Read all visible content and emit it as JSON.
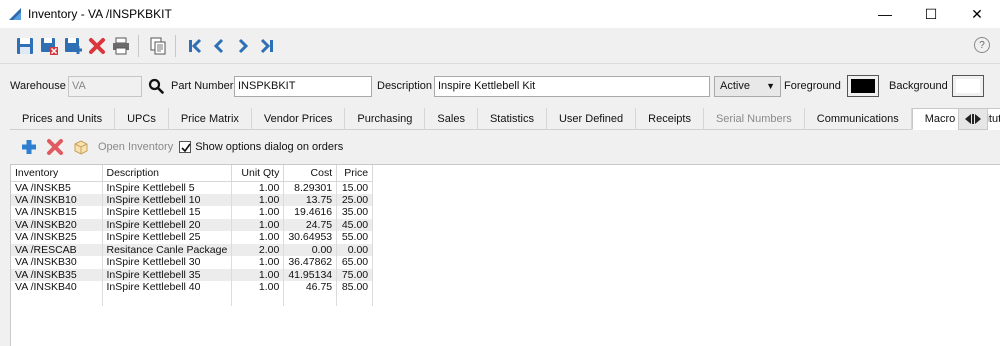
{
  "window": {
    "title": "Inventory - VA   /INSPKBKIT",
    "minimize": "—",
    "maximize": "☐",
    "close": "✕"
  },
  "toolbar": {
    "buttons": [
      "save-icon",
      "save-close-icon",
      "save-new-icon",
      "delete-icon",
      "print-icon",
      "copy-icon",
      "first-icon",
      "previous-icon",
      "next-icon",
      "last-icon"
    ],
    "help": "?"
  },
  "header": {
    "warehouse_label": "Warehouse",
    "warehouse_value": "VA",
    "part_number_label": "Part Number",
    "part_number_value": "INSPKBKIT",
    "description_label": "Description",
    "description_value": "Inspire Kettlebell Kit",
    "status_value": "Active",
    "foreground_label": "Foreground",
    "foreground_color": "#000000",
    "background_label": "Background",
    "background_color": "#ffffff"
  },
  "tabs": [
    {
      "label": "Prices and Units"
    },
    {
      "label": "UPCs"
    },
    {
      "label": "Price Matrix"
    },
    {
      "label": "Vendor Prices"
    },
    {
      "label": "Purchasing"
    },
    {
      "label": "Sales"
    },
    {
      "label": "Statistics"
    },
    {
      "label": "User Defined"
    },
    {
      "label": "Receipts"
    },
    {
      "label": "Serial Numbers"
    },
    {
      "label": "Communications"
    },
    {
      "label": "Macro Substitutions"
    }
  ],
  "macro": {
    "open_inventory_label": "Open Inventory",
    "show_options_label": "Show options dialog on orders",
    "show_options_checked": true,
    "columns": [
      "Inventory",
      "Description",
      "Unit Qty",
      "Cost",
      "Price"
    ],
    "rows": [
      {
        "inventory": "VA   /INSKB5",
        "description": "InSpire Kettlebell 5",
        "unit_qty": "1.00",
        "cost": "8.29301",
        "price": "15.00"
      },
      {
        "inventory": "VA   /INSKB10",
        "description": "InSpire Kettlebell 10",
        "unit_qty": "1.00",
        "cost": "13.75",
        "price": "25.00"
      },
      {
        "inventory": "VA   /INSKB15",
        "description": "InSpire Kettlebell 15",
        "unit_qty": "1.00",
        "cost": "19.4616",
        "price": "35.00"
      },
      {
        "inventory": "VA   /INSKB20",
        "description": "InSpire Kettlebell 20",
        "unit_qty": "1.00",
        "cost": "24.75",
        "price": "45.00"
      },
      {
        "inventory": "VA   /INSKB25",
        "description": "InSpire Kettlebell 25",
        "unit_qty": "1.00",
        "cost": "30.64953",
        "price": "55.00"
      },
      {
        "inventory": "VA   /RESCAB",
        "description": "Resitance Canle Package",
        "unit_qty": "2.00",
        "cost": "0.00",
        "price": "0.00"
      },
      {
        "inventory": "VA   /INSKB30",
        "description": "InSpire Kettlebell 30",
        "unit_qty": "1.00",
        "cost": "36.47862",
        "price": "65.00"
      },
      {
        "inventory": "VA   /INSKB35",
        "description": "InSpire Kettlebell 35",
        "unit_qty": "1.00",
        "cost": "41.95134",
        "price": "75.00"
      },
      {
        "inventory": "VA   /INSKB40",
        "description": "InSpire Kettlebell 40",
        "unit_qty": "1.00",
        "cost": "46.75",
        "price": "85.00"
      }
    ]
  }
}
